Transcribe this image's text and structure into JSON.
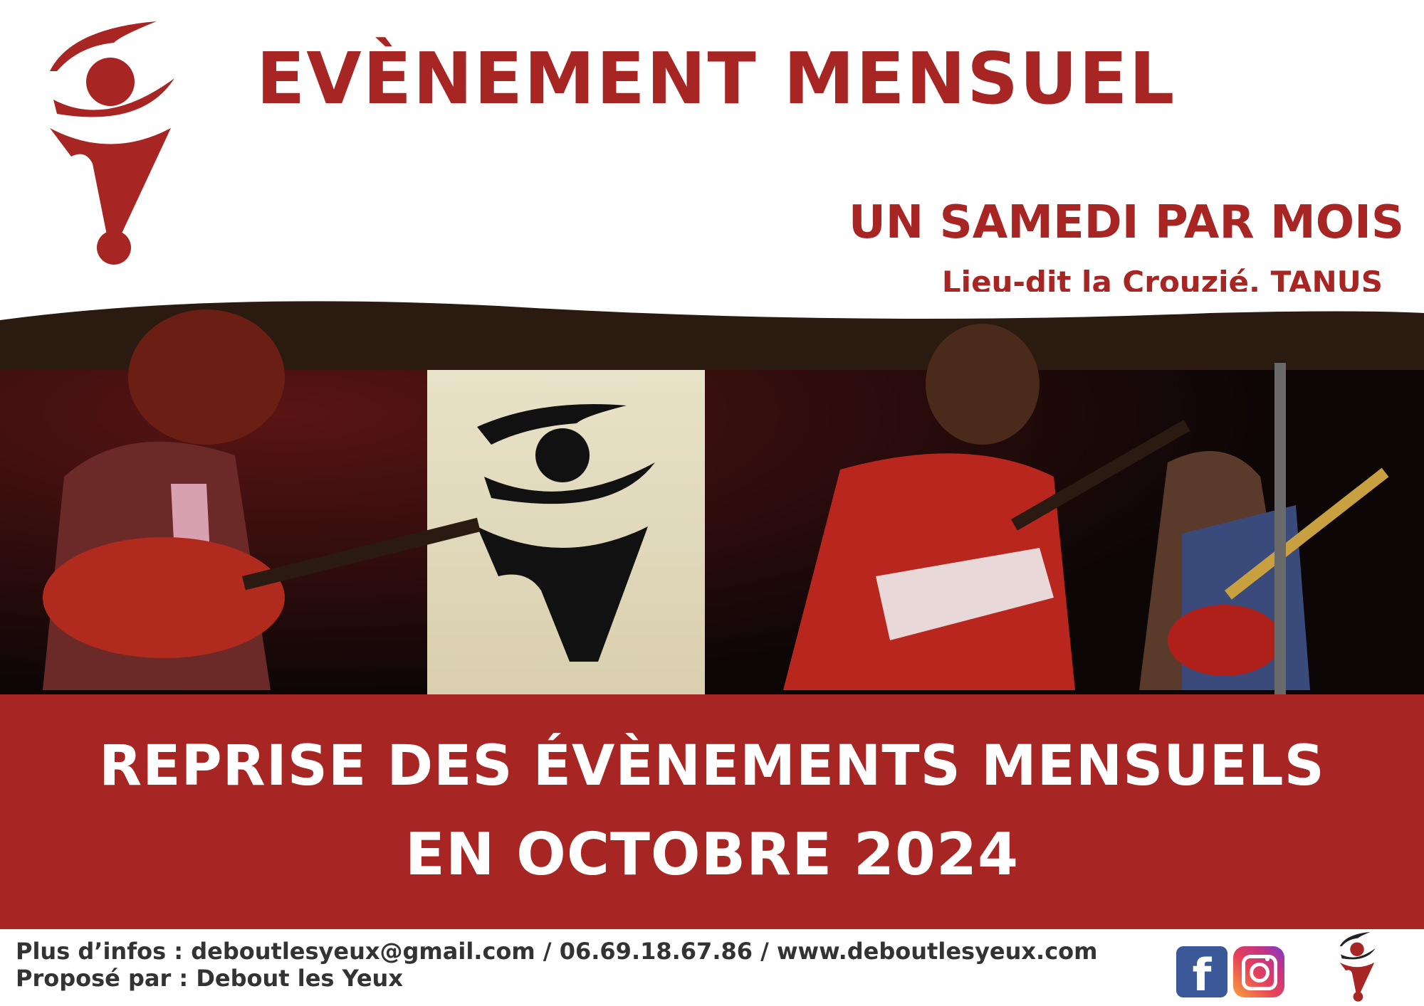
{
  "header": {
    "title": "EVÈNEMENT MENSUEL",
    "subtitle": "UN SAMEDI PAR MOIS",
    "location": "Lieu-dit la Crouzié, TANUS"
  },
  "banner": {
    "line1": "REPRISE DES ÉVÈNEMENTS MENSUELS",
    "line2": "EN OCTOBRE 2024"
  },
  "footer": {
    "contact": "Plus d’infos : deboutlesyeux@gmail.com / 06.69.18.67.86 / www.deboutlesyeux.com",
    "proposed_by": "Proposé par : Debout les Yeux",
    "facebook_glyph": "f"
  },
  "icons": [
    "logo-icon",
    "facebook-icon",
    "instagram-icon"
  ],
  "colors": {
    "brand_red": "#a72523",
    "text_dark": "#333333",
    "facebook_blue": "#3b5998"
  }
}
